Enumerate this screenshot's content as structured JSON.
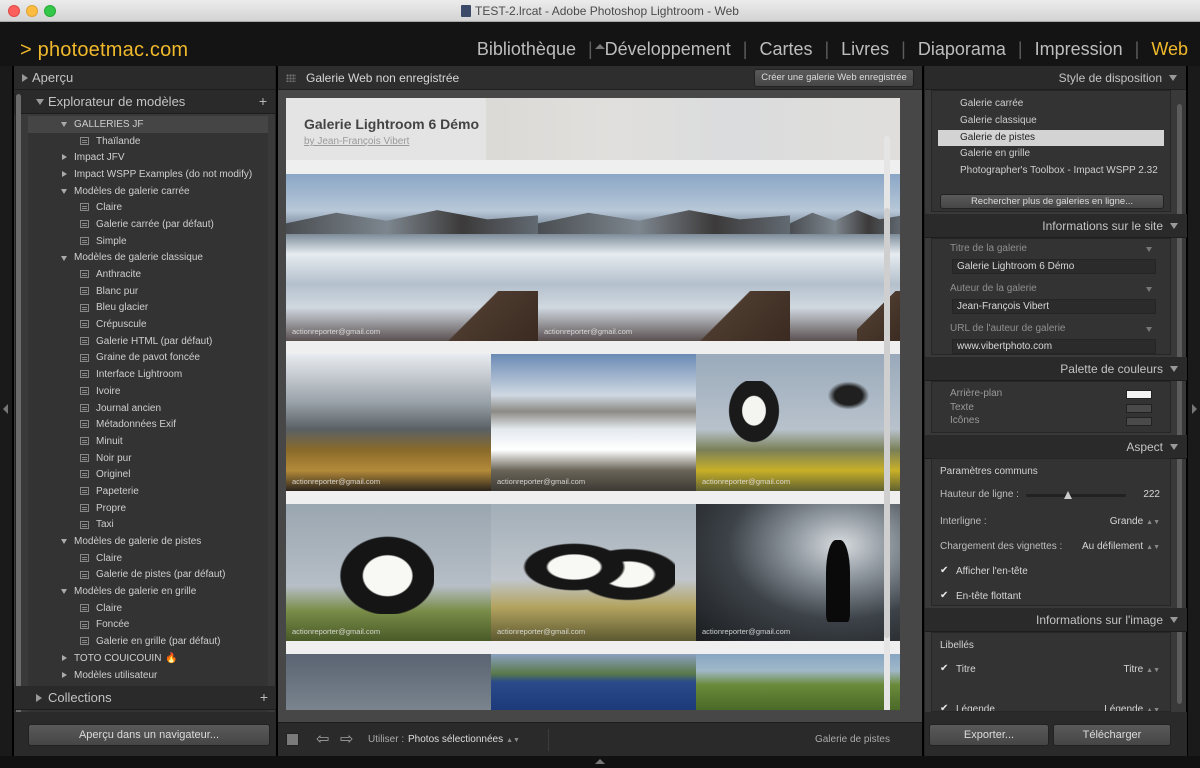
{
  "window": {
    "title": "TEST-2.lrcat - Adobe Photoshop Lightroom - Web"
  },
  "header": {
    "brand": "> photoetmac.com",
    "modules": [
      {
        "label": "Bibliothèque",
        "active": false
      },
      {
        "label": "Développement",
        "active": false
      },
      {
        "label": "Cartes",
        "active": false
      },
      {
        "label": "Livres",
        "active": false
      },
      {
        "label": "Diaporama",
        "active": false
      },
      {
        "label": "Impression",
        "active": false
      },
      {
        "label": "Web",
        "active": true
      }
    ]
  },
  "left_panel": {
    "preview_label": "Aperçu",
    "template_browser_label": "Explorateur de modèles",
    "add_symbol": "+",
    "tree": [
      {
        "type": "folder",
        "label": "GALLERIES JF",
        "expanded": true,
        "highlight": true
      },
      {
        "type": "preset",
        "label": "Thaïlande"
      },
      {
        "type": "folder",
        "label": "Impact JFV",
        "expanded": false
      },
      {
        "type": "folder",
        "label": "Impact WSPP Examples (do not modify)",
        "expanded": false
      },
      {
        "type": "folder",
        "label": "Modèles de galerie carrée",
        "expanded": true
      },
      {
        "type": "preset",
        "label": "Claire"
      },
      {
        "type": "preset",
        "label": "Galerie carrée (par défaut)"
      },
      {
        "type": "preset",
        "label": "Simple"
      },
      {
        "type": "folder",
        "label": "Modèles de galerie classique",
        "expanded": true
      },
      {
        "type": "preset",
        "label": "Anthracite"
      },
      {
        "type": "preset",
        "label": "Blanc pur"
      },
      {
        "type": "preset",
        "label": "Bleu glacier"
      },
      {
        "type": "preset",
        "label": "Crépuscule"
      },
      {
        "type": "preset",
        "label": "Galerie HTML (par défaut)"
      },
      {
        "type": "preset",
        "label": "Graine de pavot foncée"
      },
      {
        "type": "preset",
        "label": "Interface Lightroom"
      },
      {
        "type": "preset",
        "label": "Ivoire"
      },
      {
        "type": "preset",
        "label": "Journal ancien"
      },
      {
        "type": "preset",
        "label": "Métadonnées Exif"
      },
      {
        "type": "preset",
        "label": "Minuit"
      },
      {
        "type": "preset",
        "label": "Noir pur"
      },
      {
        "type": "preset",
        "label": "Originel"
      },
      {
        "type": "preset",
        "label": "Papeterie"
      },
      {
        "type": "preset",
        "label": "Propre"
      },
      {
        "type": "preset",
        "label": "Taxi"
      },
      {
        "type": "folder",
        "label": "Modèles de galerie de pistes",
        "expanded": true
      },
      {
        "type": "preset",
        "label": "Claire"
      },
      {
        "type": "preset",
        "label": "Galerie de pistes (par défaut)"
      },
      {
        "type": "folder",
        "label": "Modèles de galerie en grille",
        "expanded": true
      },
      {
        "type": "preset",
        "label": "Claire"
      },
      {
        "type": "preset",
        "label": "Foncée"
      },
      {
        "type": "preset",
        "label": "Galerie en grille (par défaut)"
      },
      {
        "type": "folder",
        "label": "TOTO COUICOUIN",
        "expanded": false,
        "badge": "🔥"
      },
      {
        "type": "folder",
        "label": "Modèles utilisateur",
        "expanded": false
      }
    ],
    "collections_label": "Collections",
    "preview_browser_button": "Aperçu dans un navigateur..."
  },
  "center": {
    "gallery_name": "Galerie Web non enregistrée",
    "save_gallery_button": "Créer une galerie Web enregistrée",
    "gallery_title": "Galerie Lightroom 6 Démo",
    "gallery_author": "by Jean-François Vibert",
    "watermark": "actionreporter@gmail.com",
    "bottom": {
      "use_label": "Utiliser :",
      "use_value": "Photos sélectionnées",
      "gallery_type": "Galerie de pistes"
    }
  },
  "right_panel": {
    "layout_style": {
      "label": "Style de disposition",
      "items": [
        {
          "label": "Galerie carrée",
          "selected": false
        },
        {
          "label": "Galerie classique",
          "selected": false
        },
        {
          "label": "Galerie de pistes",
          "selected": true
        },
        {
          "label": "Galerie en grille",
          "selected": false
        },
        {
          "label": "Photographer's Toolbox - Impact WSPP 2.32",
          "selected": false
        }
      ],
      "find_more_button": "Rechercher plus de galeries en ligne..."
    },
    "site_info": {
      "label": "Informations sur le site",
      "fields": [
        {
          "label": "Titre de la galerie",
          "value": "Galerie Lightroom 6 Démo"
        },
        {
          "label": "Auteur de la galerie",
          "value": "Jean-François Vibert"
        },
        {
          "label": "URL de l'auteur de galerie",
          "value": "www.vibertphoto.com"
        }
      ]
    },
    "color_palette": {
      "label": "Palette de couleurs",
      "items": [
        {
          "label": "Arrière-plan",
          "color": "#f2f2f2"
        },
        {
          "label": "Texte",
          "color": "#4a4a4a"
        },
        {
          "label": "Icônes",
          "color": "#4a4a4a"
        }
      ]
    },
    "appearance": {
      "label": "Aspect",
      "common_params": "Paramètres communs",
      "row_height_label": "Hauteur de ligne :",
      "row_height_value": "222",
      "row_height_fraction": 0.42,
      "line_spacing_label": "Interligne :",
      "line_spacing_value": "Grande",
      "thumb_loading_label": "Chargement des vignettes :",
      "thumb_loading_value": "Au défilement",
      "show_header_label": "Afficher l'en-tête",
      "floating_header_label": "En-tête flottant"
    },
    "image_info": {
      "label": "Informations sur l'image",
      "labels_head": "Libellés",
      "title_label": "Titre",
      "title_value": "Titre",
      "caption_label": "Légende",
      "caption_value": "Légende"
    },
    "export_button": "Exporter...",
    "upload_button": "Télécharger"
  },
  "check_symbol": "✔"
}
